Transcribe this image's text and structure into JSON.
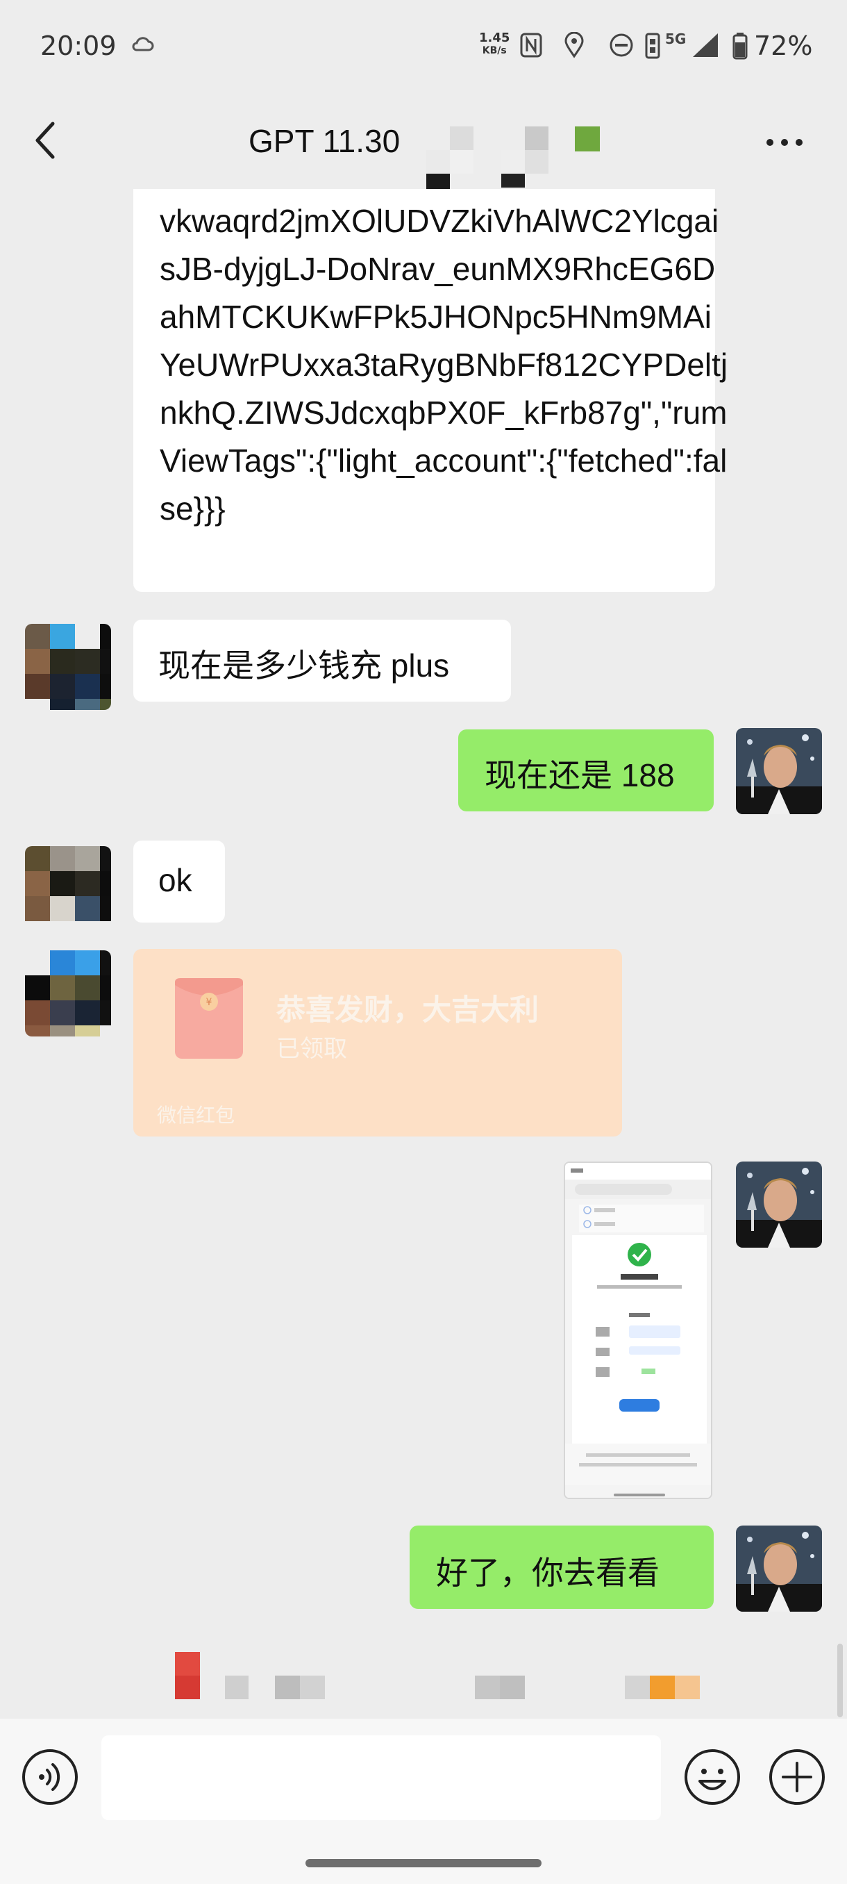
{
  "status_bar": {
    "time": "20:09",
    "net_speed_value": "1.45",
    "net_speed_unit": "KB/s",
    "network": "5G",
    "battery": "72%"
  },
  "header": {
    "title": "GPT 11.30",
    "back_icon": "chevron-left-icon",
    "more_icon": "more-dots-icon"
  },
  "messages": [
    {
      "side": "left",
      "type": "text",
      "text": "vkwaqrd2jmXOlUDVZkiVhAlWC2YlcgaisJB-dyjgLJ-DoNrav_eunMX9RhcEG6DahMTCKUKwFPk5JHONpc5HNm9MAiYeUWrPUxxa3taRygBNbFf812CYPDeltjnkhQ.ZIWSJdcxqbPX0F_kFrb87g\",\"rumViewTags\":{\"light_account\":{\"fetched\":false}}}"
    },
    {
      "side": "left",
      "type": "text",
      "text": "现在是多少钱充 plus"
    },
    {
      "side": "right",
      "type": "text",
      "text": "现在还是 188"
    },
    {
      "side": "left",
      "type": "text",
      "text": "ok"
    },
    {
      "side": "left",
      "type": "red_packet",
      "title": "恭喜发财，大吉大利",
      "status": "已领取",
      "footer": "微信红包"
    },
    {
      "side": "right",
      "type": "image",
      "description": "payment-success-screenshot"
    },
    {
      "side": "right",
      "type": "text",
      "text": "好了，你去看看"
    }
  ],
  "input_bar": {
    "placeholder": "",
    "voice_icon": "voice-icon",
    "emoji_icon": "emoji-icon",
    "plus_icon": "plus-icon"
  },
  "colors": {
    "background": "#ededed",
    "own_bubble": "#95ec69",
    "other_bubble": "#ffffff",
    "red_packet": "#fde0c6"
  }
}
